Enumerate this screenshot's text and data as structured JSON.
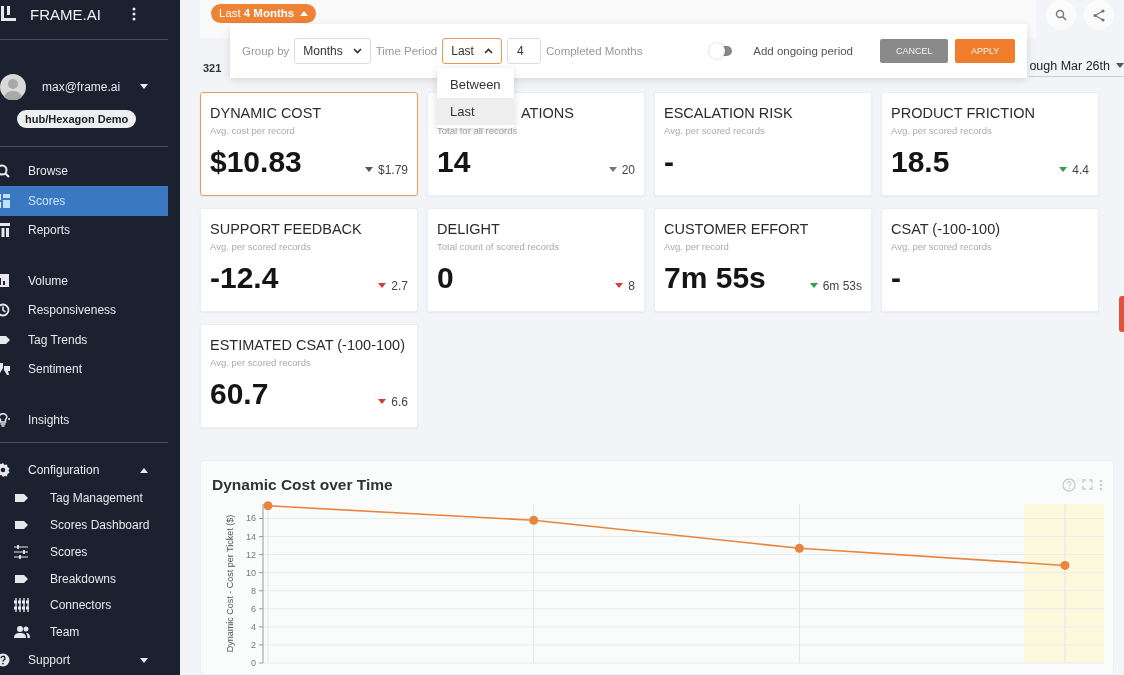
{
  "sidebar": {
    "brand": "FRAME.AI",
    "user": {
      "email": "max@frame.ai"
    },
    "workspace": "hub/Hexagon Demo",
    "groups": [
      {
        "items": [
          {
            "label": "Browse",
            "selected": false
          },
          {
            "label": "Scores",
            "selected": true
          },
          {
            "label": "Reports",
            "selected": false
          }
        ]
      },
      {
        "items": [
          {
            "label": "Volume",
            "selected": false
          },
          {
            "label": "Responsiveness",
            "selected": false
          },
          {
            "label": "Tag Trends",
            "selected": false
          },
          {
            "label": "Sentiment",
            "selected": false
          }
        ]
      },
      {
        "items": [
          {
            "label": "Insights",
            "selected": false
          }
        ]
      }
    ],
    "sections": [
      {
        "label": "Configuration",
        "expanded": true,
        "children": [
          {
            "label": "Tag Management",
            "selected": false
          },
          {
            "label": "Scores Dashboard",
            "selected": false
          },
          {
            "label": "Scores",
            "selected": false
          },
          {
            "label": "Breakdowns",
            "selected": false
          },
          {
            "label": "Connectors",
            "selected": false
          },
          {
            "label": "Team",
            "selected": false
          }
        ]
      },
      {
        "label": "Support",
        "expanded": false
      }
    ]
  },
  "period_chip": {
    "prefix": "Last",
    "value": "4 Months",
    "expanded": true
  },
  "record_count": "321",
  "date_range": "ough Mar 26th",
  "filter_popup": {
    "group_by_label": "Group by",
    "group_by": "Months",
    "time_period_label": "Time Period",
    "time_period": "Last",
    "time_period_open": true,
    "count": "4",
    "unit_label": "Completed Months",
    "ongoing": {
      "label": "Add ongoing period",
      "on": false
    },
    "buttons": [
      {
        "label": "CANCEL",
        "kind": "secondary"
      },
      {
        "label": "APPLY",
        "kind": "primary"
      }
    ],
    "menu": [
      {
        "label": "Between",
        "selected": false
      },
      {
        "label": "Last",
        "selected": true
      }
    ]
  },
  "cards": [
    {
      "title": "DYNAMIC COST",
      "subtitle": "Avg. cost per record",
      "value": "$10.83",
      "delta": "$1.79",
      "color": "#555555",
      "selected": true
    },
    {
      "title": "ATIONS",
      "subtitle": "Total for all records",
      "value": "14",
      "delta": "20",
      "color": "#777777",
      "selected": false
    },
    {
      "title": "ESCALATION RISK",
      "subtitle": "Avg. per scored records",
      "value": "-",
      "selected": false
    },
    {
      "title": "PRODUCT FRICTION",
      "subtitle": "Avg. per scored records",
      "value": "18.5",
      "delta": "4.4",
      "color": "#2e9e4f",
      "selected": false
    },
    {
      "title": "SUPPORT FEEDBACK",
      "subtitle": "Avg. per scored records",
      "value": "-12.4",
      "delta": "2.7",
      "color": "#d93a3a",
      "selected": false
    },
    {
      "title": "DELIGHT",
      "subtitle": "Total count of scored records",
      "value": "0",
      "delta": "8",
      "color": "#d93a3a",
      "selected": false
    },
    {
      "title": "CUSTOMER EFFORT",
      "subtitle": "Avg. per record",
      "value": "7m 55s",
      "delta": "6m 53s",
      "color": "#2e9e4f",
      "selected": false
    },
    {
      "title": "CSAT (-100-100)",
      "subtitle": "Avg. per scored records",
      "value": "-",
      "selected": false
    },
    {
      "title": "ESTIMATED CSAT (-100-100)",
      "subtitle": "Avg. per scored records",
      "value": "60.7",
      "delta": "6.6",
      "color": "#d93a3a",
      "selected": false
    }
  ],
  "chart": {
    "title": "Dynamic Cost over Time",
    "chart_data": {
      "type": "line",
      "ylabel": "Dynamic Cost - Cost per Ticket ($)",
      "grid": true,
      "ylim": [
        0,
        17.6
      ],
      "yticks": [
        0,
        2,
        4,
        6,
        8,
        10,
        12,
        14,
        16
      ],
      "series": [
        {
          "color": "#e8843c",
          "marker": "circle",
          "values": [
            17.4,
            15.8,
            12.7,
            10.8
          ]
        }
      ]
    }
  }
}
